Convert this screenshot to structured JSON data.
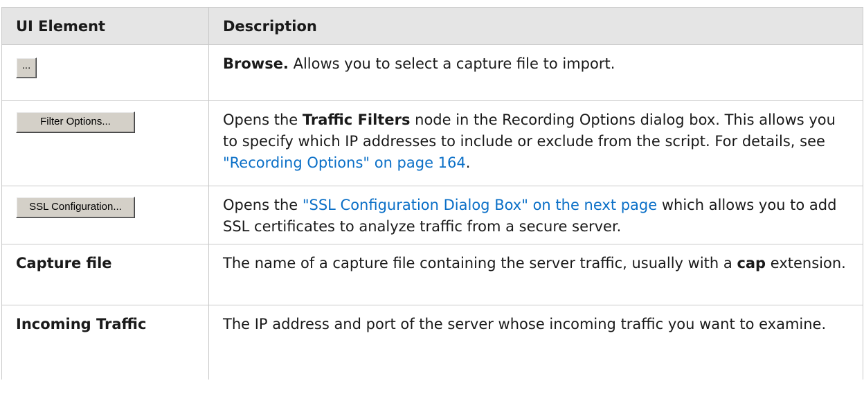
{
  "header": {
    "col1": "UI Element",
    "col2": "Description"
  },
  "rows": [
    {
      "element_button_label": "...",
      "desc_bold": "Browse.",
      "desc_text": " Allows you to select a capture file to import."
    },
    {
      "element_button_label": "Filter Options...",
      "desc_pre": "Opens the ",
      "desc_bold": "Traffic Filters",
      "desc_mid": " node in the Recording Options dialog box. This allows you to specify which IP addresses to include or exclude from the script. For details, see ",
      "desc_link": "\"Recording Options\" on page 164",
      "desc_post": "."
    },
    {
      "element_button_label": "SSL Configuration...",
      "desc_pre": "Opens the ",
      "desc_link": "\"SSL Configuration Dialog Box\" on the next page",
      "desc_post": " which allows you to add SSL certificates to analyze traffic from a secure server."
    },
    {
      "element_label": "Capture file",
      "desc_pre": "The name of a capture file containing the server traffic, usually with a ",
      "desc_bold": "cap",
      "desc_post": " extension."
    },
    {
      "element_label": "Incoming Traffic",
      "desc_text": "The IP address and port of the server whose incoming traffic you want to examine."
    }
  ],
  "colors": {
    "header_bg": "#e5e5e5",
    "border": "#c9c9c9",
    "link": "#0a6fc7",
    "button_face": "#d4d0c8"
  }
}
